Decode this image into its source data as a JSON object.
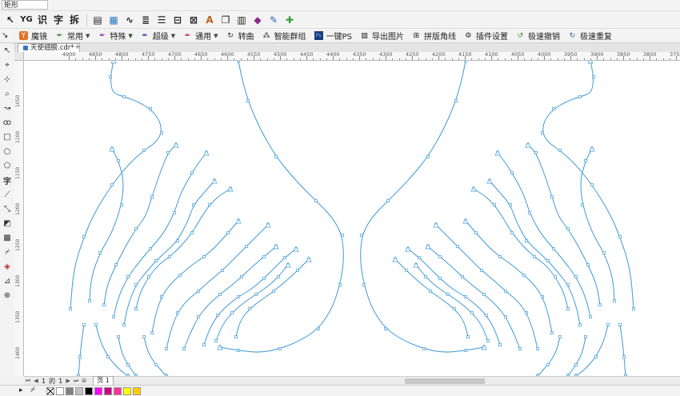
{
  "property_bar": {
    "shape_select": "矩形"
  },
  "toolbar": {
    "text_buttons": [
      "识",
      "字",
      "拆"
    ]
  },
  "plugins": [
    {
      "label": "魔镜",
      "icon": "mirror-icon",
      "color": "#e0742a",
      "dropdown": false
    },
    {
      "label": "常用",
      "icon": "pen-tool-icon",
      "color": "#3a8a3a",
      "dropdown": true
    },
    {
      "label": "特殊",
      "icon": "pen-tool-icon",
      "color": "#8a3ab0",
      "dropdown": true
    },
    {
      "label": "超级",
      "icon": "pen-tool-icon",
      "color": "#2a4ab0",
      "dropdown": true
    },
    {
      "label": "通用",
      "icon": "pen-tool-icon",
      "color": "#c0306a",
      "dropdown": true
    },
    {
      "label": "转曲",
      "icon": "convert-curve-icon",
      "color": "#444444",
      "dropdown": false
    },
    {
      "label": "智能群组",
      "icon": "group-icon",
      "color": "#444444",
      "dropdown": false
    },
    {
      "label": "一键PS",
      "icon": "photoshop-icon",
      "color": "#1c3d7a",
      "dropdown": false
    },
    {
      "label": "导出图片",
      "icon": "export-image-icon",
      "color": "#444444",
      "dropdown": false
    },
    {
      "label": "拼版角线",
      "icon": "crop-marks-icon",
      "color": "#444444",
      "dropdown": false
    },
    {
      "label": "插件设置",
      "icon": "gear-icon",
      "color": "#222222",
      "dropdown": false
    },
    {
      "label": "极速撤销",
      "icon": "undo-icon",
      "color": "#3a8a3a",
      "dropdown": false
    },
    {
      "label": "极速重复",
      "icon": "redo-icon",
      "color": "#2a6ab0",
      "dropdown": false
    }
  ],
  "document": {
    "tab_title": "天使翅膀.cdr*"
  },
  "ruler": {
    "h_labels": [
      "4900",
      "4850",
      "4800",
      "4750",
      "4700",
      "4650",
      "4600",
      "4550",
      "4500",
      "4450",
      "4400",
      "4350",
      "4300",
      "4250",
      "4200",
      "4150",
      "4100",
      "4050",
      "4000",
      "3950",
      "3900",
      "3850",
      "3800",
      "3750",
      "3700"
    ],
    "v_labels": [
      "1050",
      "1100",
      "1150",
      "1200",
      "1250",
      "1300",
      "1350",
      "1400",
      "1450"
    ]
  },
  "pages": {
    "current": "1",
    "of_label": "的",
    "total": "1",
    "page_tab": "页 1"
  },
  "colors": {
    "curve": "#3d9ad8",
    "palette": [
      "#ffffff",
      "#808080",
      "#c0c0c0",
      "#000000",
      "#ff00ff",
      "#cc0088",
      "#ff3399",
      "#ffff00",
      "#ffcc00"
    ]
  }
}
